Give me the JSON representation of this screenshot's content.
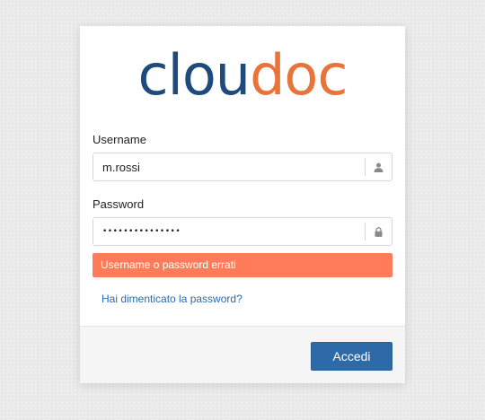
{
  "brand": {
    "logo_part1": "clou",
    "logo_part2": "doc",
    "color_primary": "#1e4a7c",
    "color_accent": "#e8743b"
  },
  "form": {
    "username": {
      "label": "Username",
      "value": "m.rossi",
      "icon": "user-icon"
    },
    "password": {
      "label": "Password",
      "value": "•••••••••••••••",
      "icon": "lock-icon"
    },
    "error_message": "Username o password errati",
    "error_color": "#ff7b59",
    "forgot_link": "Hai dimenticato la password?",
    "submit_label": "Accedi",
    "submit_color": "#2f6aa8"
  }
}
